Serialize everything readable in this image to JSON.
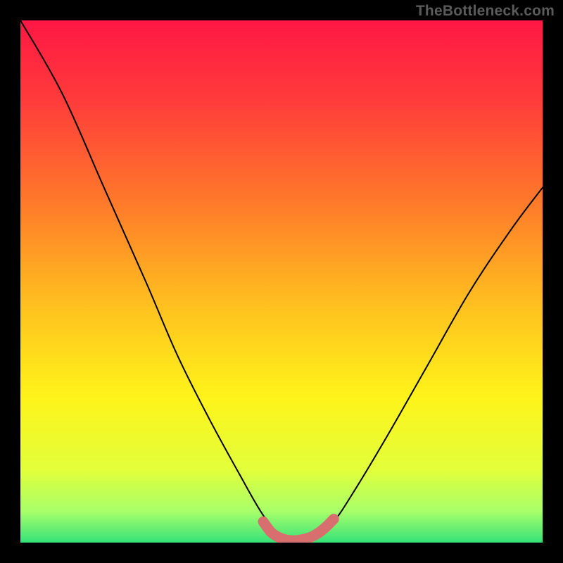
{
  "watermark": "TheBottleneck.com",
  "chart_data": {
    "type": "line",
    "title": "",
    "xlabel": "",
    "ylabel": "",
    "xlim": [
      0,
      100
    ],
    "ylim": [
      0,
      100
    ],
    "background_gradient": {
      "stops": [
        {
          "offset": 0.0,
          "color": "#ff1744"
        },
        {
          "offset": 0.15,
          "color": "#ff3b3b"
        },
        {
          "offset": 0.35,
          "color": "#ff7a2a"
        },
        {
          "offset": 0.55,
          "color": "#ffc21f"
        },
        {
          "offset": 0.72,
          "color": "#fff31a"
        },
        {
          "offset": 0.86,
          "color": "#e2ff3a"
        },
        {
          "offset": 0.94,
          "color": "#a8ff6a"
        },
        {
          "offset": 1.0,
          "color": "#36e27a"
        }
      ]
    },
    "series": [
      {
        "name": "bottleneck-curve",
        "color": "#000000",
        "x": [
          0,
          8,
          16,
          24,
          30,
          36,
          42,
          46,
          49,
          51,
          53,
          55,
          57,
          60,
          64,
          70,
          78,
          86,
          94,
          100
        ],
        "y": [
          100,
          86,
          68,
          50,
          36,
          24,
          13,
          6,
          2,
          0.7,
          0.3,
          0.5,
          1.5,
          4,
          10,
          20,
          34,
          48,
          60,
          68
        ]
      }
    ],
    "highlight": {
      "name": "optimal-zone",
      "color": "#d86e6e",
      "x": [
        46.5,
        48,
        49.5,
        51,
        52.5,
        54,
        55.5,
        57,
        58.5,
        60
      ],
      "y": [
        4.0,
        2.0,
        1.0,
        0.5,
        0.4,
        0.6,
        1.0,
        1.8,
        3.0,
        4.5
      ]
    }
  }
}
